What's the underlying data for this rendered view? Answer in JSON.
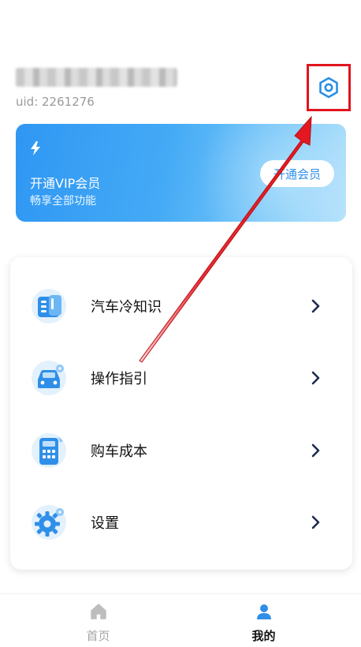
{
  "profile": {
    "uid_text": "uid: 2261276"
  },
  "vip": {
    "title": "开通VIP会员",
    "subtitle": "畅享全部功能",
    "button_label": "开通会员"
  },
  "menu": {
    "items": [
      {
        "label": "汽车冷知识",
        "icon": "book-icon"
      },
      {
        "label": "操作指引",
        "icon": "car-guide-icon"
      },
      {
        "label": "购车成本",
        "icon": "calculator-icon"
      },
      {
        "label": "设置",
        "icon": "gear-icon"
      }
    ]
  },
  "bottom_nav": {
    "tabs": [
      {
        "label": "首页",
        "icon": "home-icon",
        "active": false
      },
      {
        "label": "我的",
        "icon": "user-icon",
        "active": true
      }
    ]
  },
  "colors": {
    "accent": "#2f97f3",
    "highlight": "#e0141c",
    "nav_inactive": "#a5a5a5"
  }
}
